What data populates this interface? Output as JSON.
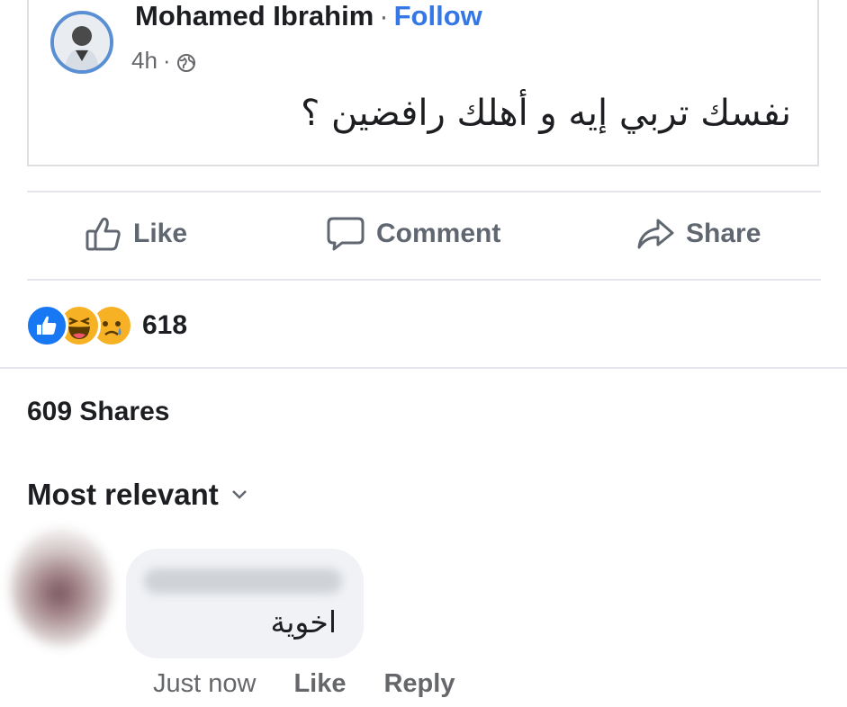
{
  "post": {
    "author": "Mohamed Ibrahim",
    "separator": "·",
    "follow_label": "Follow",
    "time": "4h",
    "time_separator": "·",
    "audience_icon": "globe-icon",
    "text": "نفسك تربي إيه و أهلك رافضين ؟"
  },
  "actions": {
    "like_label": "Like",
    "comment_label": "Comment",
    "share_label": "Share"
  },
  "stats": {
    "reaction_icons": [
      "like-reaction-icon",
      "haha-reaction-icon",
      "sad-reaction-icon"
    ],
    "reaction_count": "618",
    "shares": "609 Shares"
  },
  "comments": {
    "sort_label": "Most relevant",
    "items": [
      {
        "text": "اخوية",
        "time": "Just now",
        "like_label": "Like",
        "reply_label": "Reply"
      }
    ]
  },
  "colors": {
    "link_blue": "#3578e5",
    "like_blue": "#1877f2",
    "reaction_yellow": "#f7b125",
    "muted_text": "#606770",
    "bubble_bg": "#f0f2f5"
  }
}
